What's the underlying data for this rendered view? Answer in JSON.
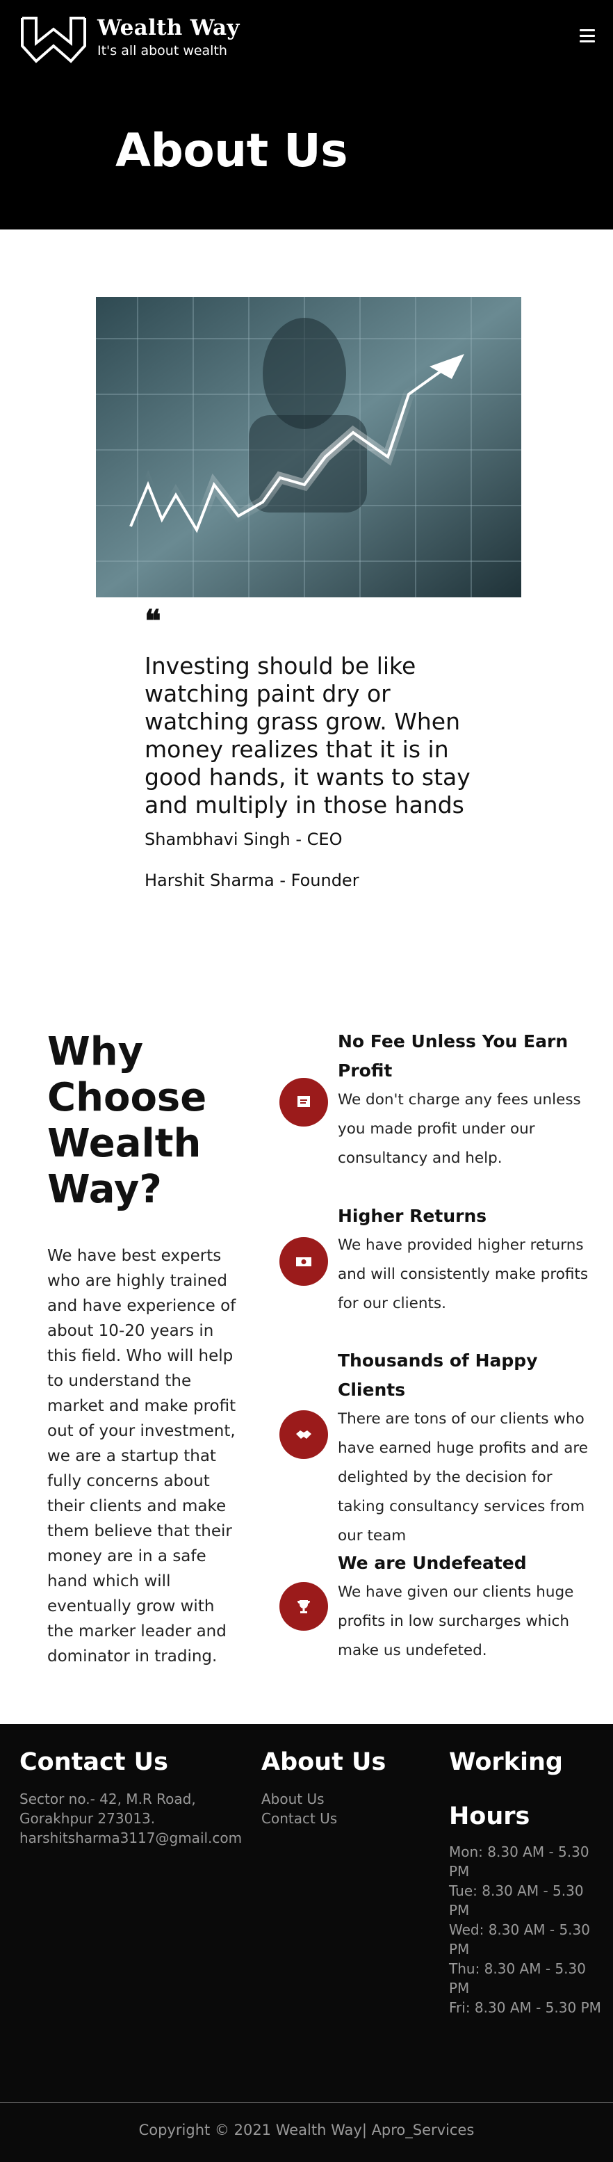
{
  "brand": {
    "name": "Wealth Way",
    "tagline": "It's all about wealth"
  },
  "header": {
    "title": "About Us"
  },
  "quote": {
    "text": "Investing should be like watching paint dry or watching grass grow. When money realizes that it is in good hands, it wants to stay and multiply in those hands",
    "mark": "❝"
  },
  "team": [
    {
      "label": "Shambhavi Singh - CEO"
    },
    {
      "label": "Harshit Sharma - Founder"
    }
  ],
  "why": {
    "title": "Why Choose Wealth Way?",
    "body": "We have best experts who are highly trained and have experience of about 10-20 years in this field. Who will help to understand the market and make profit out of your investment, we are a startup that fully concerns about their clients and make them believe that their money are in a safe hand which will eventually grow with the marker leader and dominator in trading."
  },
  "features": [
    {
      "title": "No Fee Unless You Earn Profit",
      "text": "We don't charge any fees unless you made profit under our consultancy and help.",
      "icon": "receipt-icon"
    },
    {
      "title": "Higher Returns",
      "text": "We have provided higher returns and will consistently make profits for our clients.",
      "icon": "money-icon"
    },
    {
      "title": "Thousands of Happy Clients",
      "text": "There are tons of our clients who have earned huge profits and are delighted by the decision for taking consultancy services from our team",
      "icon": "handshake-icon"
    },
    {
      "title": "We are Undefeated",
      "text": "We have given our clients huge profits in low surcharges which make us undefeted.",
      "icon": "trophy-icon"
    }
  ],
  "footer": {
    "contact": {
      "title": "Contact Us",
      "lines": [
        "Sector no.- 42, M.R Road,",
        "Gorakhpur 273013.",
        "harshitsharma3117@gmail.com"
      ]
    },
    "about": {
      "title": "About Us",
      "links": [
        "About Us",
        "Contact Us"
      ]
    },
    "hours": {
      "title_line1": "Working",
      "title_line2": "Hours",
      "lines": [
        "Mon: 8.30 AM - 5.30 PM",
        "Tue: 8.30 AM - 5.30 PM",
        "Wed: 8.30 AM - 5.30 PM",
        "Thu: 8.30 AM - 5.30 PM",
        "Fri: 8.30 AM - 5.30 PM"
      ]
    },
    "copyright": "Copyright © 2021 Wealth Way| Apro_Services"
  },
  "colors": {
    "header_bg": "#000000",
    "accent": "#9b1b1b",
    "footer_bg": "#0a0a0a"
  }
}
